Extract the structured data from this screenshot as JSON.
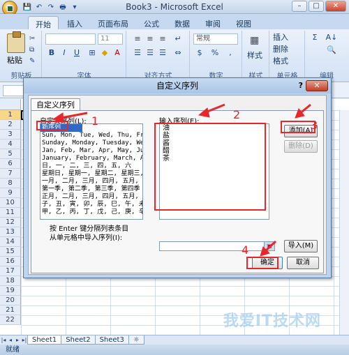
{
  "window": {
    "title": "Book3 - Microsoft Excel",
    "minimize_glyph": "–",
    "maximize_glyph": "□",
    "close_glyph": "✕"
  },
  "qat": {
    "save": "💾",
    "undo": "↶",
    "redo": "↷",
    "print": "🖶",
    "more": "▾"
  },
  "tabs": [
    {
      "label": "开始",
      "active": true
    },
    {
      "label": "插入"
    },
    {
      "label": "页面布局"
    },
    {
      "label": "公式"
    },
    {
      "label": "数据"
    },
    {
      "label": "审阅"
    },
    {
      "label": "视图"
    }
  ],
  "ribbon": {
    "clipboard": {
      "paste": "粘贴",
      "group_label": "剪贴板"
    },
    "font": {
      "size_value": "11",
      "group_label": "字体",
      "bold": "B",
      "italic": "I",
      "underline": "U"
    },
    "alignment": {
      "group_label": "对齐方式"
    },
    "number": {
      "format_value": "常规",
      "percent": "%",
      "comma": ",",
      "currency": "$",
      "group_label": "数字"
    },
    "styles": {
      "label": "样式",
      "group_label": "样式"
    },
    "cells": {
      "insert": "插入",
      "delete": "删除",
      "format": "格式",
      "group_label": "单元格"
    },
    "editing": {
      "sum": "Σ",
      "sort": "A↓",
      "find": "🔍",
      "group_label": "编辑"
    }
  },
  "grid": {
    "rows": [
      "1",
      "2",
      "3",
      "4",
      "5",
      "6",
      "7",
      "8",
      "9",
      "10",
      "11",
      "12",
      "13",
      "14",
      "15",
      "16",
      "17",
      "18",
      "19",
      "20",
      "21",
      "22"
    ]
  },
  "sheets": [
    "Sheet1",
    "Sheet2",
    "Sheet3"
  ],
  "status": "就绪",
  "watermark": "我爱IT技术网",
  "dialog": {
    "title": "自定义序列",
    "help": "?",
    "close": "✕",
    "tab": "自定义序列",
    "list_label": "自定义序列(L):",
    "entries_label": "输入序列(E):",
    "lists": [
      "新序列",
      "Sun, Mon, Tue, Wed, Thu, Fri, S",
      "Sunday, Monday, Tuesday, Wednes",
      "Jan, Feb, Mar, Apr, May, Jun, J",
      "January, February, March, April",
      "日, 一, 二, 三, 四, 五, 六",
      "星期日, 星期一, 星期二, 星期三,",
      "一月, 二月, 三月, 四月, 五月, 六",
      "第一季, 第二季, 第三季, 第四季",
      "正月, 二月, 三月, 四月, 五月, 六",
      "子, 丑, 寅, 卯, 辰, 巳, 午, 未,",
      "甲, 乙, 丙, 丁, 戊, 己, 庚, 辛,"
    ],
    "entries": [
      "油",
      "盐",
      "酱",
      "醋",
      "茶"
    ],
    "add_button": "添加(A)",
    "delete_button": "删除(D)",
    "hint_line1": "按 Enter 键分隔列表条目",
    "hint_line2": "从单元格中导入序列(I):",
    "import_button": "导入(M)",
    "ok_button": "确定",
    "cancel_button": "取消"
  },
  "annotations": {
    "step1": "1",
    "step2": "2",
    "step3": "3",
    "step4": "4",
    "color": "#e8272d"
  }
}
